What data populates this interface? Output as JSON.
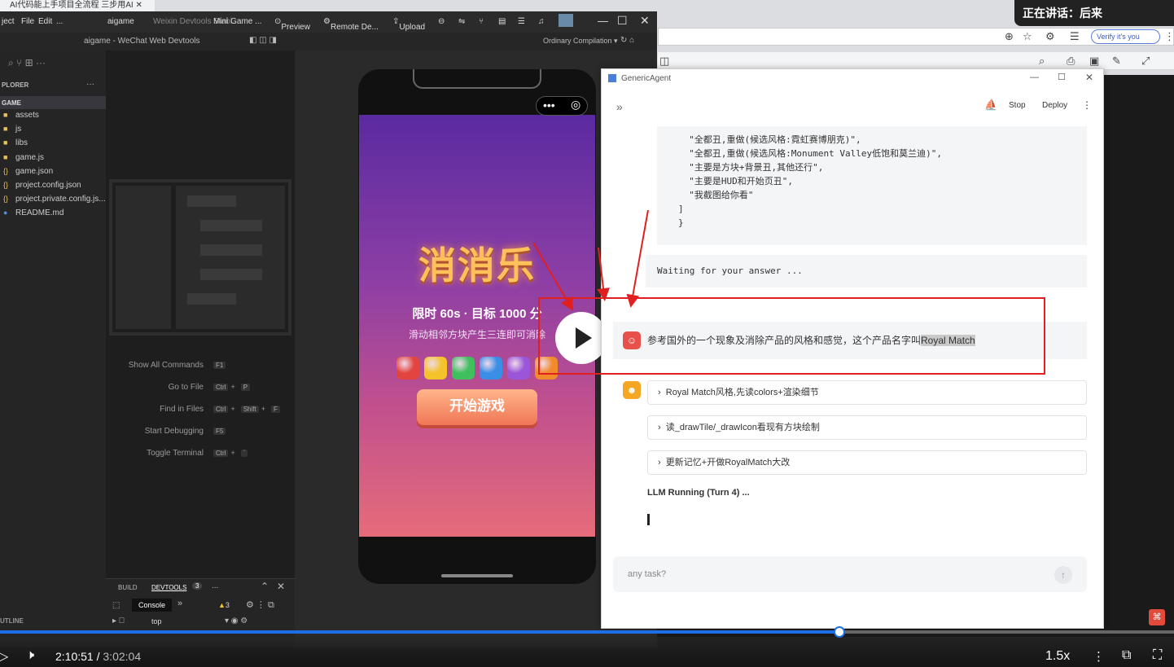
{
  "browser": {
    "tab_title": "AI代码能上手项目全流程 三步用AI",
    "verify_label": "Verify it's you",
    "speaking": "正在讲话：后来"
  },
  "devtools": {
    "menu": [
      "ject",
      "File",
      "Edit",
      "..."
    ],
    "title_items": [
      "aigame",
      "Weixin Devtools Stabl...",
      "Mini Game ...",
      "Preview",
      "Remote De...",
      "Upload"
    ],
    "window_title": "aigame - WeChat Web Devtools",
    "compile_mode": "Ordinary Compilation ▾",
    "explorer_label": "PLORER",
    "project_label": "GAME",
    "files": [
      {
        "name": "assets",
        "icon": "folder-icon"
      },
      {
        "name": "js",
        "icon": "folder-icon"
      },
      {
        "name": "libs",
        "icon": "folder-icon"
      },
      {
        "name": "game.js",
        "icon": "js-file-icon"
      },
      {
        "name": "game.json",
        "icon": "json-file-icon"
      },
      {
        "name": "project.config.json",
        "icon": "json-file-icon"
      },
      {
        "name": "project.private.config.js...",
        "icon": "json-file-icon"
      },
      {
        "name": "README.md",
        "icon": "info-icon"
      }
    ],
    "commands": [
      {
        "label": "Show All Commands",
        "keys": [
          "F1"
        ]
      },
      {
        "label": "Go to File",
        "keys": [
          "Ctrl",
          "+",
          "P"
        ]
      },
      {
        "label": "Find in Files",
        "keys": [
          "Ctrl",
          "+",
          "Shift",
          "+",
          "F"
        ]
      },
      {
        "label": "Start Debugging",
        "keys": [
          "F5"
        ]
      },
      {
        "label": "Toggle Terminal",
        "keys": [
          "Ctrl",
          "+",
          "`"
        ]
      }
    ],
    "bottom_tabs": [
      "BUILD",
      "DEVTOOLS",
      "3",
      "..."
    ],
    "console_tab": "Console",
    "warning_count": "3",
    "context": "top",
    "outline_label": "UTLINE"
  },
  "game": {
    "title": "消消乐",
    "subtitle": "限时 60s · 目标 1000 分",
    "hint": "滑动相邻方块产生三连即可消除",
    "start_button": "开始游戏",
    "tile_colors": [
      "#e2453f",
      "#f4c22b",
      "#3fbf5d",
      "#3a8ee6",
      "#9a55d8",
      "#f08a2a"
    ]
  },
  "agent": {
    "window_title": "GenericAgent",
    "stop_label": "Stop",
    "deploy_label": "Deploy",
    "code_lines": [
      "  \"全都丑,重做(候选风格:霓虹赛博朋克)\",",
      "  \"全都丑,重做(候选风格:Monument Valley低饱和莫兰迪)\",",
      "  \"主要是方块+背景丑,其他还行\",",
      "  \"主要是HUD和开始页丑\",",
      "  \"我截图给你看\"",
      "]",
      "}"
    ],
    "waiting": "Waiting for your answer ...",
    "user_message_prefix": "参考国外的一个现象及消除产品的风格和感觉，这个产品名字叫",
    "user_message_highlight": "Royal Match",
    "steps": [
      "Royal Match风格,先读colors+渲染细节",
      "读_drawTile/_drawIcon看现有方块绘制",
      "更新记忆+开做RoyalMatch大改"
    ],
    "status": "LLM Running (Turn 4) ...",
    "input_placeholder": "any task?"
  },
  "video": {
    "current_time": "2:10:51",
    "total_time": "3:02:04",
    "speed": "1.5x",
    "progress": 0.715
  }
}
